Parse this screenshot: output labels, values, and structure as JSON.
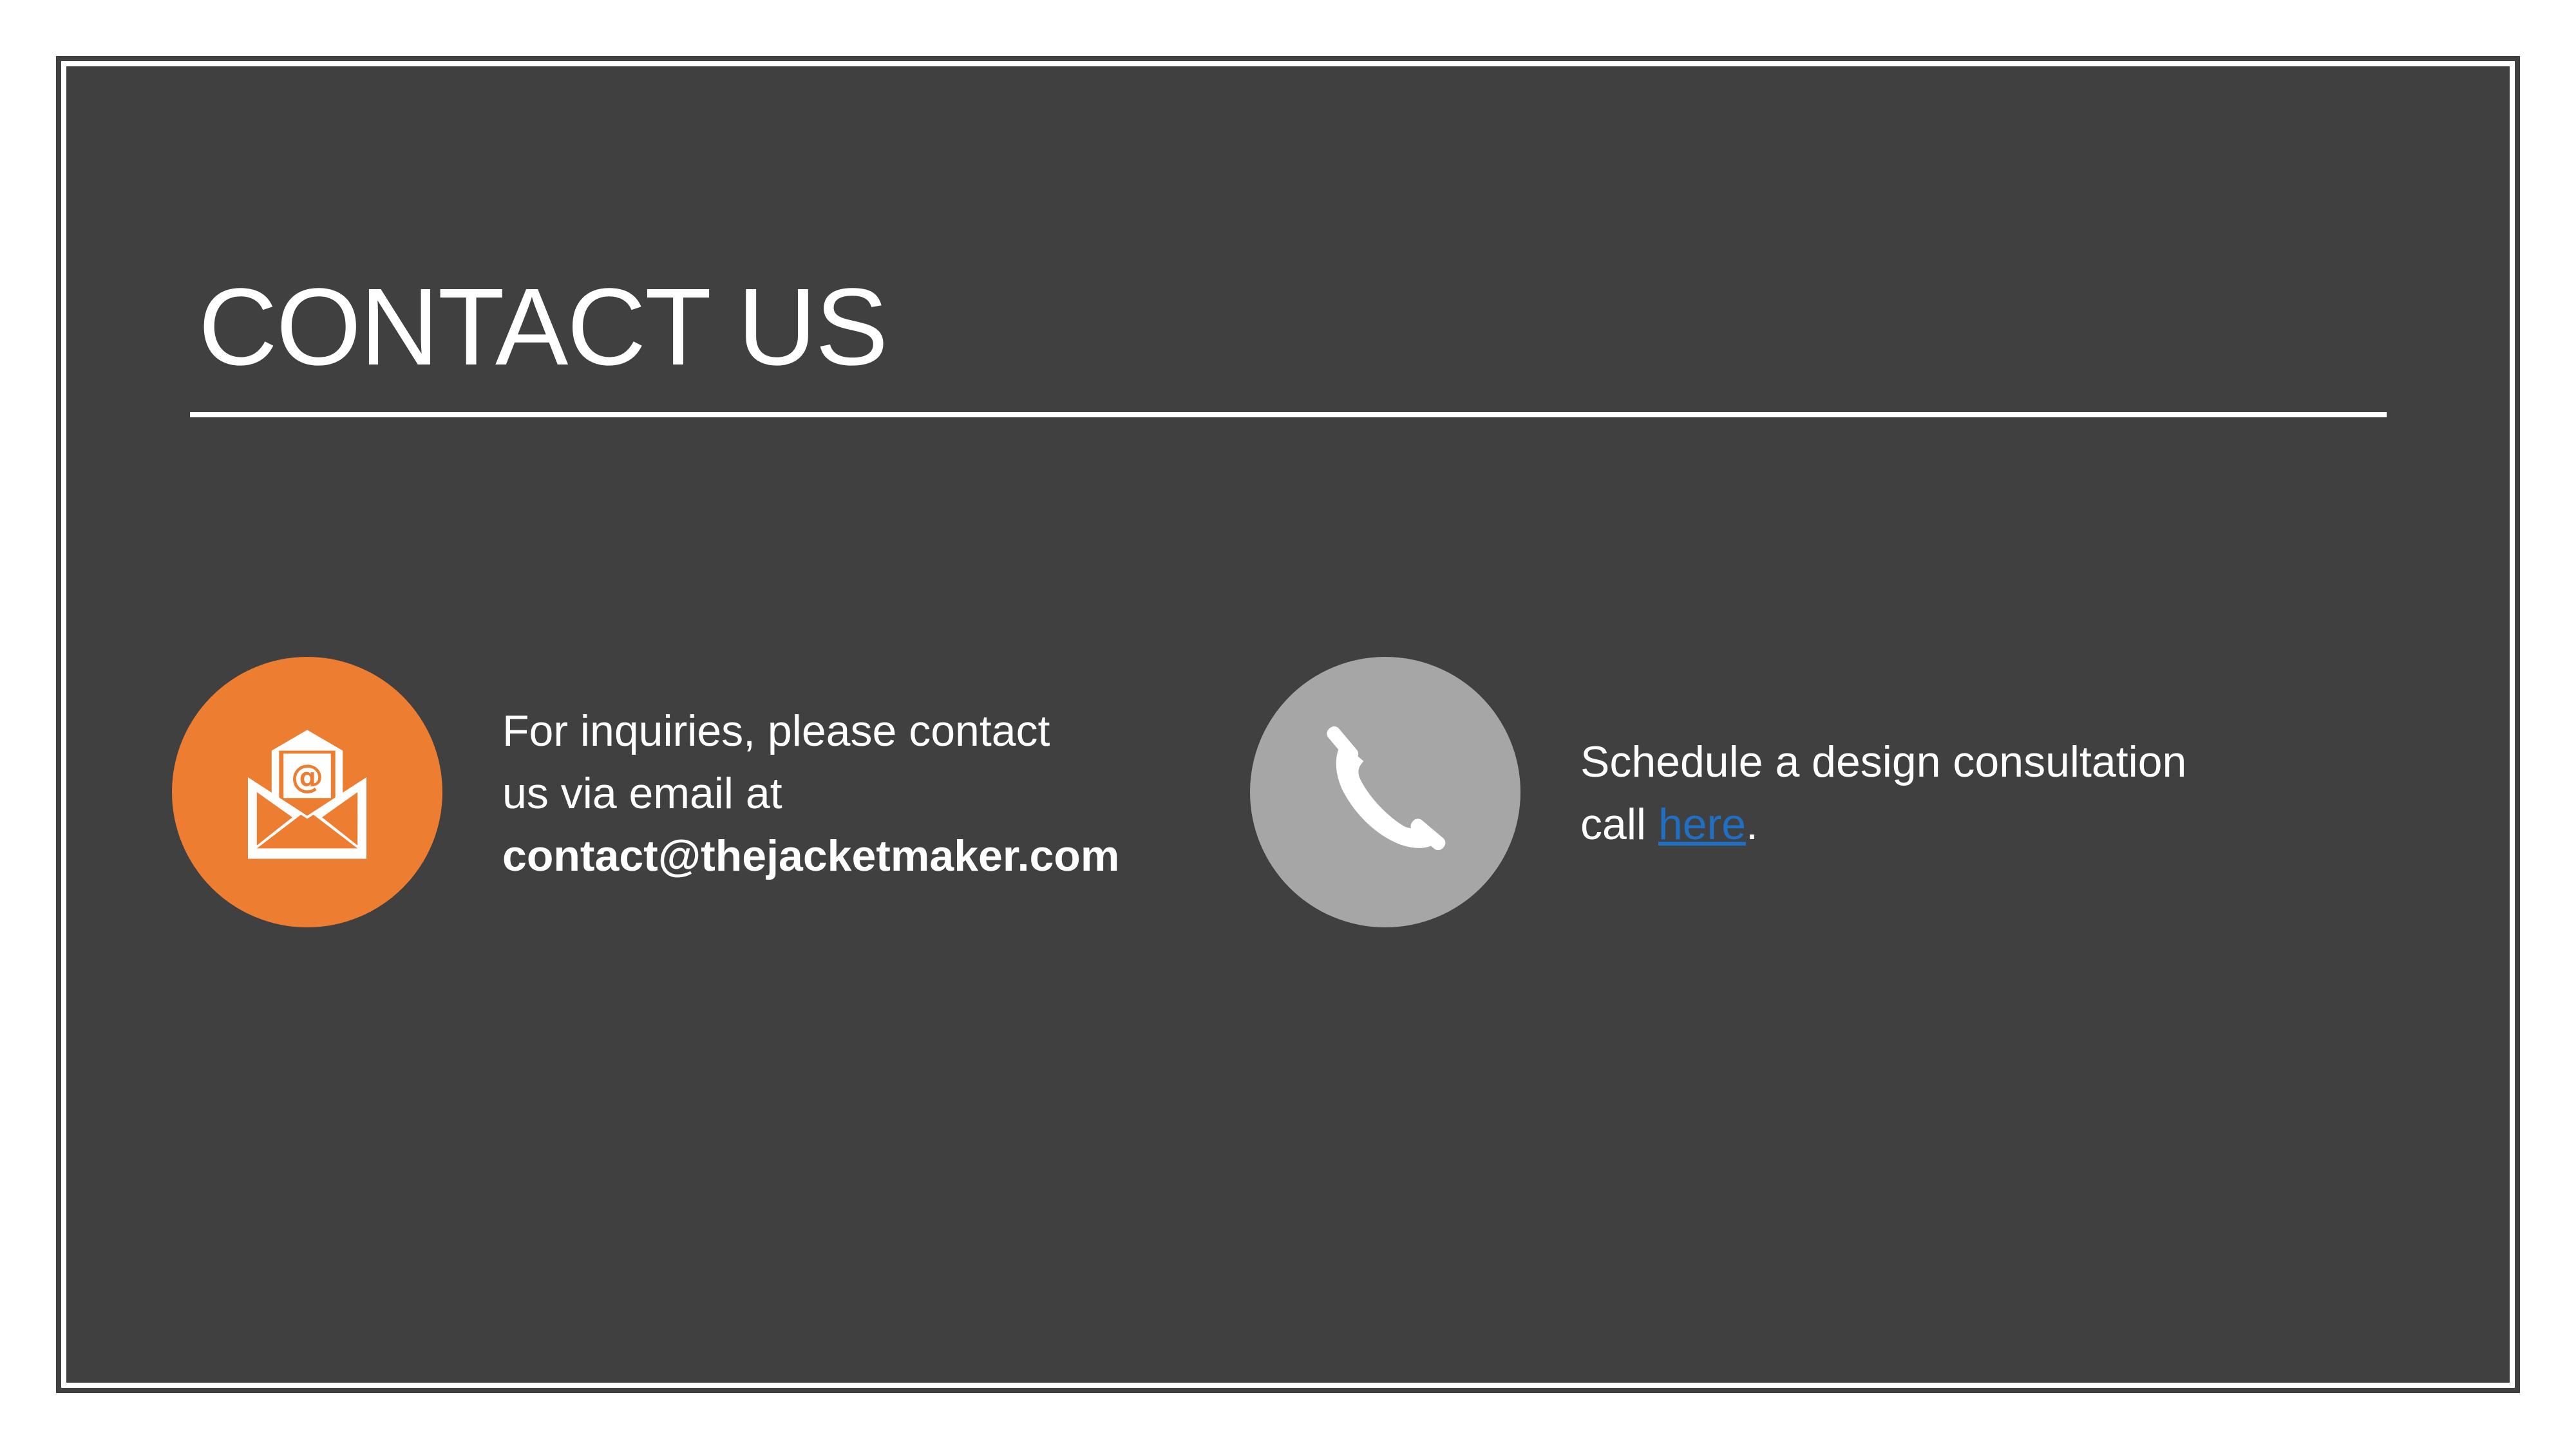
{
  "slide": {
    "title": "CONTACT US",
    "background_color": "#404040",
    "accent_color": "#ED7D31"
  },
  "email_section": {
    "icon": "envelope-at-icon",
    "line1": "For inquiries, please contact",
    "line2": "us via email at",
    "email": "contact@thejacketmaker.com"
  },
  "phone_section": {
    "icon": "phone-icon",
    "line1": "Schedule a design consultation",
    "line2_prefix": "call ",
    "link_text": "here",
    "line2_suffix": "."
  }
}
